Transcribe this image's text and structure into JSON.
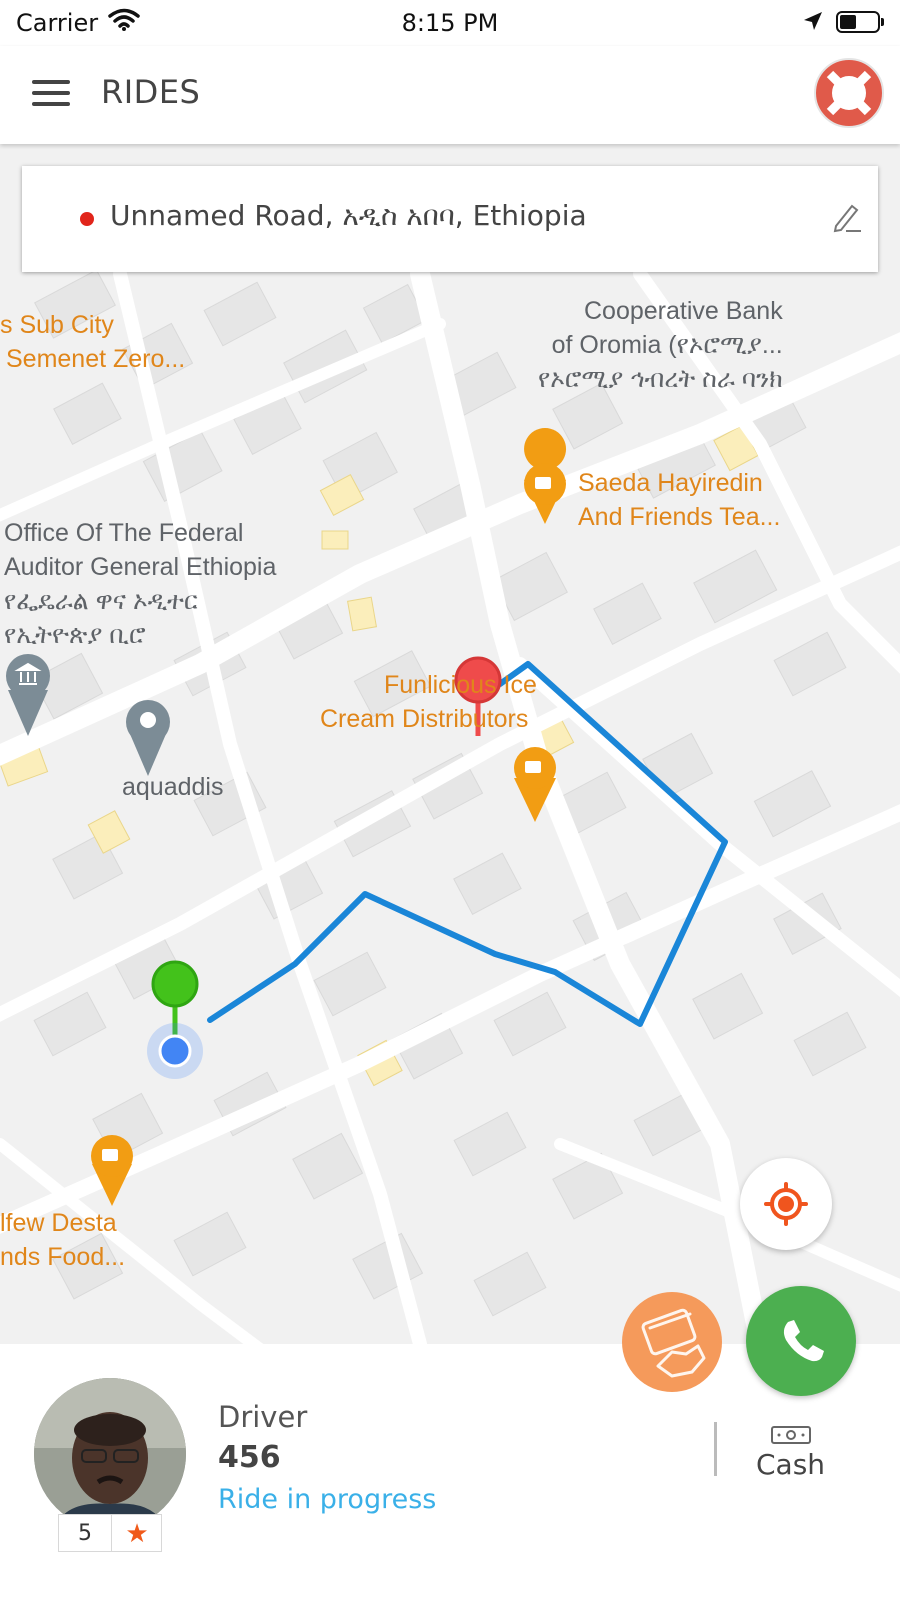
{
  "status_bar": {
    "carrier": "Carrier",
    "time": "8:15 PM",
    "icons": [
      "wifi-icon",
      "location-arrow-icon",
      "battery-icon"
    ]
  },
  "header": {
    "title": "RIDES",
    "menu_icon": "hamburger-menu-icon",
    "help_icon": "lifebuoy-icon"
  },
  "pickup": {
    "address": "Unnamed Road, አዲስ አበባ, Ethiopia",
    "edit_icon": "pencil-icon",
    "marker_color": "#e1251b"
  },
  "map": {
    "labels": [
      {
        "id": "sub-city",
        "lines": [
          "s Sub City",
          "Semenet Zero..."
        ],
        "color": "orange"
      },
      {
        "id": "cooperative-bank",
        "lines": [
          "Cooperative Bank",
          "of Oromia (የኦሮሚያ...",
          "የኦሮሚያ ኅብረት ስራ ባንክ"
        ],
        "color": "gray"
      },
      {
        "id": "saeda",
        "lines": [
          "Saeda Hayiredin",
          "And Friends Tea..."
        ],
        "color": "orange"
      },
      {
        "id": "auditor",
        "lines": [
          "Office Of The Federal",
          "Auditor General Ethiopia",
          "የፌዴራል ዋና ኦዲተር",
          "የኢትዮጵያ ቢሮ"
        ],
        "color": "gray"
      },
      {
        "id": "funlicious",
        "lines": [
          "Funlicious Ice",
          "Cream Distributors"
        ],
        "color": "orange"
      },
      {
        "id": "aquaddis",
        "lines": [
          "aquaddis"
        ],
        "color": "gray"
      },
      {
        "id": "alfew",
        "lines": [
          "lfew Desta",
          "nds Food..."
        ],
        "color": "orange"
      }
    ],
    "route_color": "#1a86d8",
    "pickup_pin_color": "#43c21b",
    "destination_pin_color": "#ef4b4b",
    "current_location_color": "#4285f4",
    "poi_color": "#f29d13"
  },
  "actions": {
    "locate_icon": "my-location-icon",
    "payment_icon": "card-payment-icon",
    "call_icon": "phone-icon",
    "payment_color": "#f59a5b",
    "call_color": "#4caf50"
  },
  "driver": {
    "label": "Driver",
    "name": "456",
    "rating": "5",
    "star_icon": "star-icon",
    "status": "Ride in progress"
  },
  "payment": {
    "method": "Cash",
    "icon": "cash-icon"
  }
}
